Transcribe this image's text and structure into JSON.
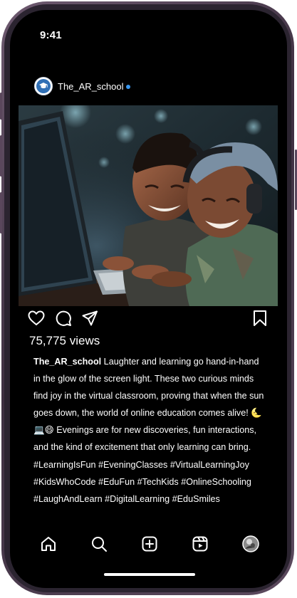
{
  "status_bar": {
    "time": "9:41"
  },
  "post": {
    "username": "The_AR_school",
    "views": "75,775 views",
    "caption": {
      "username": "The_AR_school",
      "text": " Laughter and learning go hand-in-hand in the glow of the screen light. These two curious minds find joy in the virtual classroom, proving that when the sun goes down, the world of online education comes alive! 🌜💻😄 Evenings are for new discoveries, fun interactions, and the kind of excitement that only learning can bring.",
      "hashtags": "#LearningIsFun #EveningClasses #VirtualLearningJoy #KidsWhoCode #EduFun #TechKids #OnlineSchooling #LaughAndLearn #DigitalLearning #EduSmiles"
    }
  },
  "icons": {
    "like": "heart-icon",
    "comment": "comment-icon",
    "share": "send-icon",
    "save": "bookmark-icon",
    "nav": [
      "home-icon",
      "search-icon",
      "create-icon",
      "reels-icon",
      "profile-avatar"
    ]
  },
  "colors": {
    "background": "#000000",
    "text": "#ffffff",
    "verified": "#3897f0"
  }
}
